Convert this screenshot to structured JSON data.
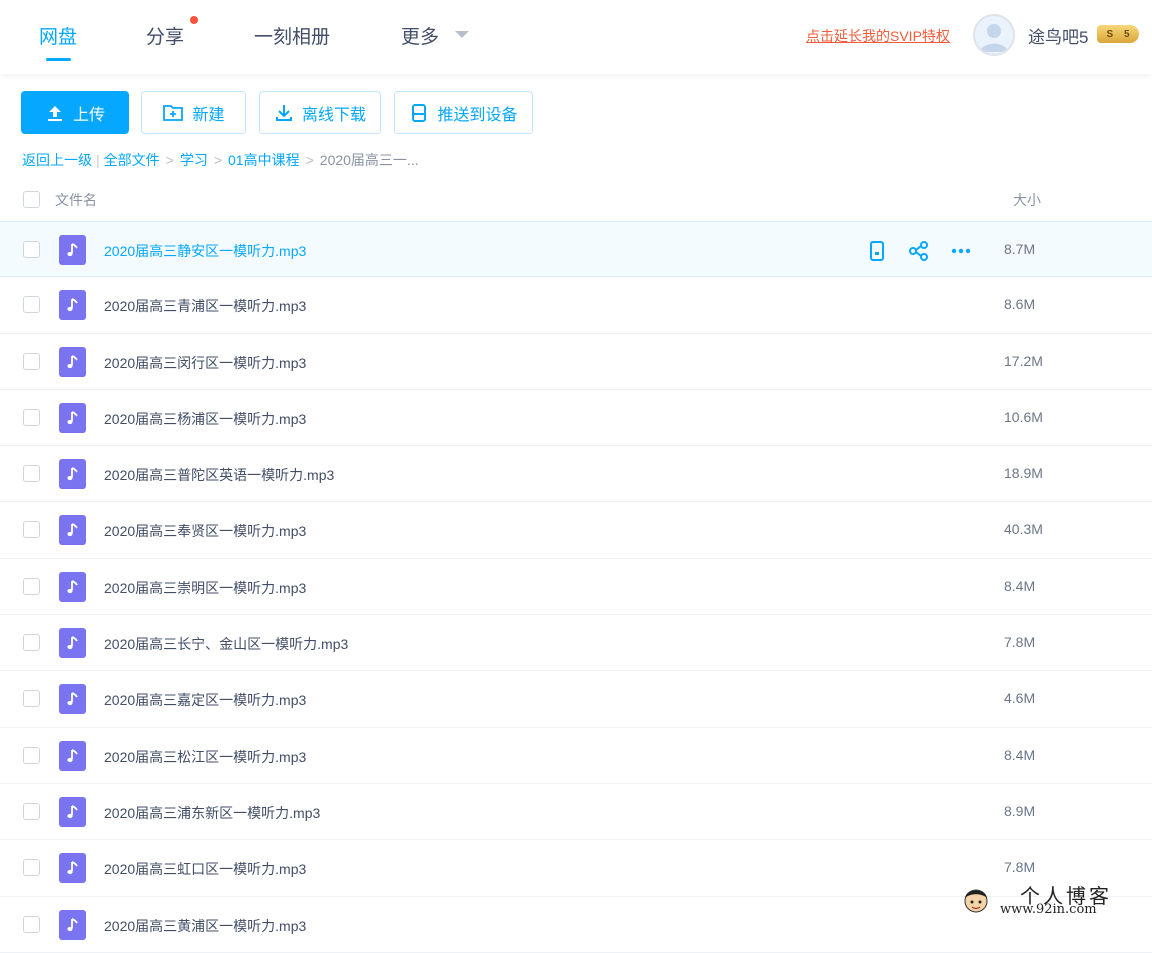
{
  "nav": {
    "items": [
      {
        "label": "网盘"
      },
      {
        "label": "分享"
      },
      {
        "label": "一刻相册"
      },
      {
        "label": "更多"
      }
    ],
    "svip_link": "点击延长我的SVIP特权",
    "username": "途鸟吧5",
    "vip_level_a": "S",
    "vip_level_b": "5"
  },
  "toolbar": {
    "upload": "上传",
    "new": "新建",
    "offline_download": "离线下载",
    "push_device": "推送到设备"
  },
  "breadcrumb": {
    "back": "返回上一级",
    "all_files": "全部文件",
    "level1": "学习",
    "level2": "01高中课程",
    "current": "2020届高三一..."
  },
  "list_header": {
    "name": "文件名",
    "size": "大小"
  },
  "files": [
    {
      "name": "2020届高三静安区一模听力.mp3",
      "size": "8.7M"
    },
    {
      "name": "2020届高三青浦区一模听力.mp3",
      "size": "8.6M"
    },
    {
      "name": "2020届高三闵行区一模听力.mp3",
      "size": "17.2M"
    },
    {
      "name": "2020届高三杨浦区一模听力.mp3",
      "size": "10.6M"
    },
    {
      "name": "2020届高三普陀区英语一模听力.mp3",
      "size": "18.9M"
    },
    {
      "name": "2020届高三奉贤区一模听力.mp3",
      "size": "40.3M"
    },
    {
      "name": "2020届高三崇明区一模听力.mp3",
      "size": "8.4M"
    },
    {
      "name": "2020届高三长宁、金山区一模听力.mp3",
      "size": "7.8M"
    },
    {
      "name": "2020届高三嘉定区一模听力.mp3",
      "size": "4.6M"
    },
    {
      "name": "2020届高三松江区一模听力.mp3",
      "size": "8.4M"
    },
    {
      "name": "2020届高三浦东新区一模听力.mp3",
      "size": "8.9M"
    },
    {
      "name": "2020届高三虹口区一模听力.mp3",
      "size": "7.8M"
    },
    {
      "name": "2020届高三黄浦区一模听力.mp3",
      "size": ""
    }
  ],
  "watermark": {
    "title": "个人博客",
    "url": "www.92in.com"
  },
  "colors": {
    "accent": "#06a7ff",
    "audio_icon": "#7b74f0",
    "svip": "#f25c3b"
  }
}
